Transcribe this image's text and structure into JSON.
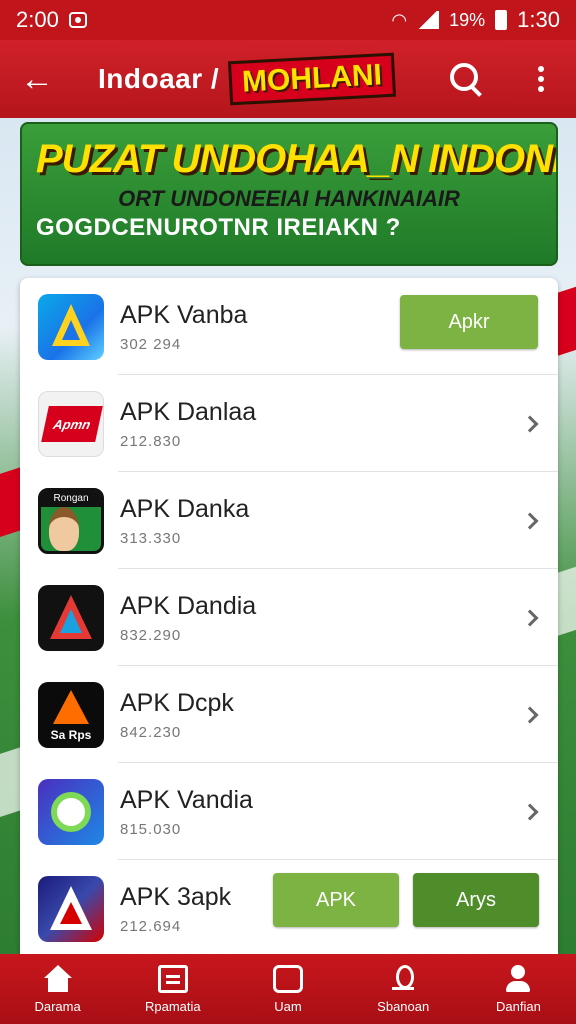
{
  "status_bar": {
    "time": "2:00",
    "battery": "19%",
    "clock_right": "1:30"
  },
  "app_bar": {
    "title_left": "Indoaar /",
    "title_badge": "MOHLANI",
    "back_icon": "arrow-left-icon",
    "search_icon": "search-icon",
    "more_icon": "more-vert-icon"
  },
  "banner": {
    "headline": "PUZAT UNDOHAA_N INDONESIA",
    "subline": "ORT UNDONEEIAI HANKINAIAIR",
    "tagline": "GOGDCENUROTNR IREIAKN ?"
  },
  "apps": [
    {
      "name": "APK Vanba",
      "sub": "302 294",
      "action": "Apkr",
      "icon": "apk-vanba-icon"
    },
    {
      "name": "APK Danlaa",
      "sub": "212.830",
      "icon": "apk-danlaa-icon",
      "icon_text": "Apmn"
    },
    {
      "name": "APK Danka",
      "sub": "313.330",
      "icon": "apk-danka-icon",
      "icon_text": "Rongan"
    },
    {
      "name": "APK Dandia",
      "sub": "832.290",
      "icon": "apk-dandia-icon"
    },
    {
      "name": "APK Dcpk",
      "sub": "842.230",
      "icon": "apk-dcpk-icon",
      "icon_text": "Sa Rps"
    },
    {
      "name": "APK Vandia",
      "sub": "815.030",
      "icon": "apk-vandia-icon"
    },
    {
      "name": "APK 3apk",
      "sub": "212.694",
      "icon": "apk-3apk-icon",
      "buttons": [
        "APK",
        "Arys"
      ]
    }
  ],
  "bottom_nav": [
    {
      "label": "Darama",
      "icon": "home-icon"
    },
    {
      "label": "Rpamatia",
      "icon": "document-icon"
    },
    {
      "label": "Uam",
      "icon": "square-icon"
    },
    {
      "label": "Sbanoan",
      "icon": "pin-icon"
    },
    {
      "label": "Danfian",
      "icon": "user-icon"
    }
  ]
}
